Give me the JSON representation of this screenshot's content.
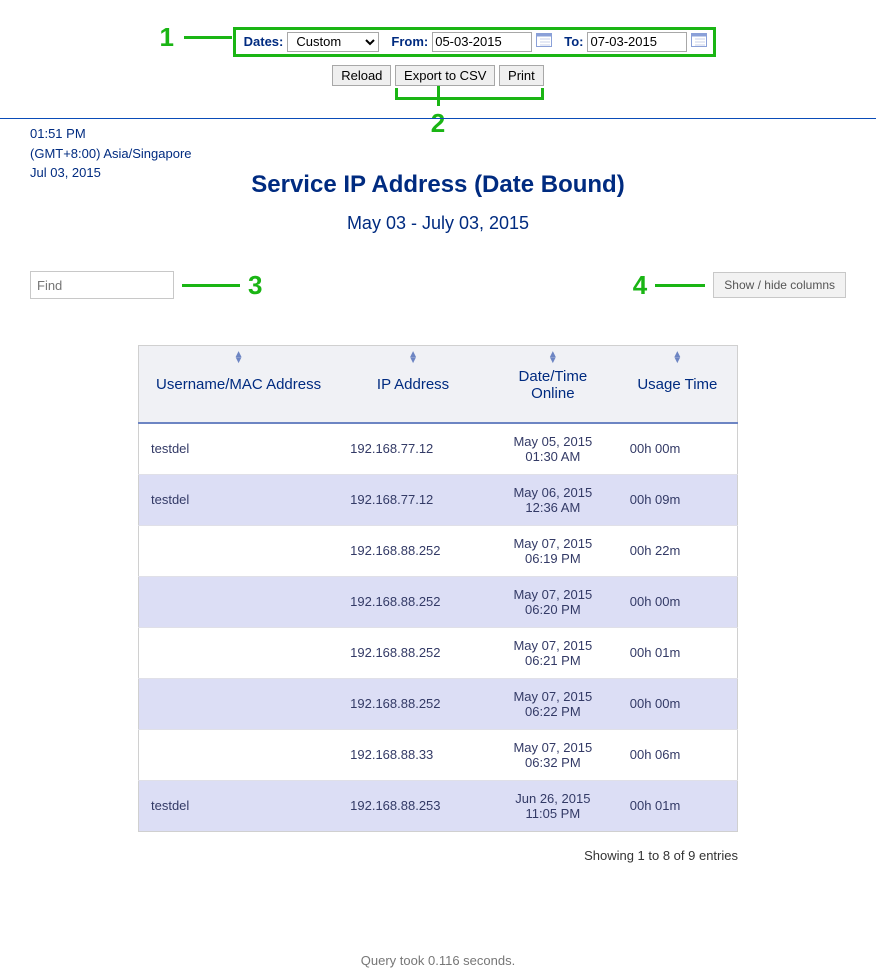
{
  "callouts": {
    "one": "1",
    "two": "2",
    "three": "3",
    "four": "4"
  },
  "toolbar": {
    "dates_label": "Dates:",
    "dates_select_value": "Custom",
    "from_label": "From:",
    "from_value": "05-03-2015",
    "to_label": "To:",
    "to_value": "07-03-2015",
    "reload": "Reload",
    "export_csv": "Export to CSV",
    "print": "Print"
  },
  "timestamp": {
    "time": "01:51 PM",
    "tz": "(GMT+8:00) Asia/Singapore",
    "date": "Jul 03, 2015"
  },
  "page": {
    "title": "Service IP Address (Date Bound)",
    "subtitle": "May 03 - July 03, 2015"
  },
  "find": {
    "placeholder": "Find"
  },
  "showhide": {
    "label": "Show / hide columns"
  },
  "table": {
    "headers": {
      "username": "Username/MAC Address",
      "ip": "IP Address",
      "datetime": "Date/Time Online",
      "usage": "Usage Time"
    },
    "rows": [
      {
        "user": "testdel",
        "ip": "192.168.77.12",
        "dt1": "May 05, 2015",
        "dt2": "01:30 AM",
        "usage": "00h 00m"
      },
      {
        "user": "testdel",
        "ip": "192.168.77.12",
        "dt1": "May 06, 2015",
        "dt2": "12:36 AM",
        "usage": "00h 09m"
      },
      {
        "user": "",
        "ip": "192.168.88.252",
        "dt1": "May 07, 2015",
        "dt2": "06:19 PM",
        "usage": "00h 22m"
      },
      {
        "user": "",
        "ip": "192.168.88.252",
        "dt1": "May 07, 2015",
        "dt2": "06:20 PM",
        "usage": "00h 00m"
      },
      {
        "user": "",
        "ip": "192.168.88.252",
        "dt1": "May 07, 2015",
        "dt2": "06:21 PM",
        "usage": "00h 01m"
      },
      {
        "user": "",
        "ip": "192.168.88.252",
        "dt1": "May 07, 2015",
        "dt2": "06:22 PM",
        "usage": "00h 00m"
      },
      {
        "user": "",
        "ip": "192.168.88.33",
        "dt1": "May 07, 2015",
        "dt2": "06:32 PM",
        "usage": "00h 06m"
      },
      {
        "user": "testdel",
        "ip": "192.168.88.253",
        "dt1": "Jun 26, 2015",
        "dt2": "11:05 PM",
        "usage": "00h 01m"
      }
    ],
    "footer": "Showing 1 to 8 of 9 entries"
  },
  "query_footer": "Query took 0.116 seconds."
}
